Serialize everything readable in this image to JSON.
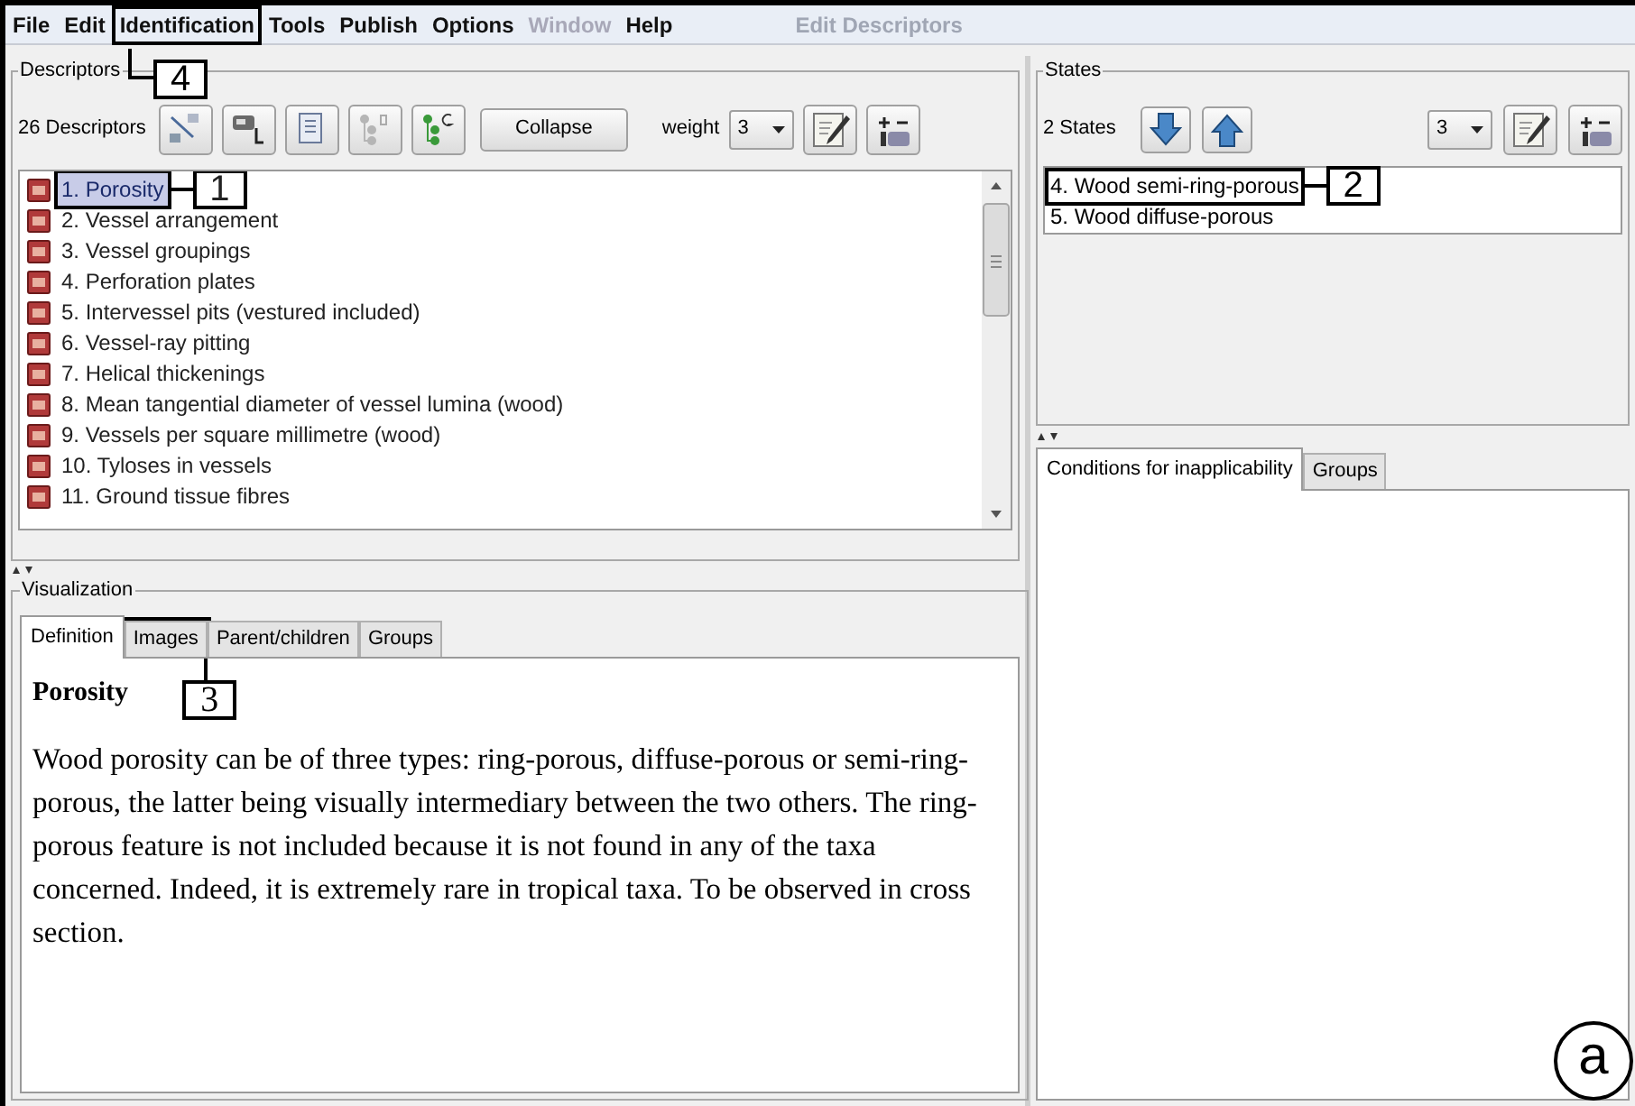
{
  "menu_bar": {
    "items": [
      {
        "label": "File",
        "disabled": false
      },
      {
        "label": "Edit",
        "disabled": false
      },
      {
        "label": "Identification",
        "disabled": false
      },
      {
        "label": "Tools",
        "disabled": false
      },
      {
        "label": "Publish",
        "disabled": false
      },
      {
        "label": "Options",
        "disabled": false
      },
      {
        "label": "Window",
        "disabled": true
      },
      {
        "label": "Help",
        "disabled": false
      }
    ],
    "window_title": "Edit Descriptors"
  },
  "descriptors": {
    "title": "Descriptors",
    "count": "26 Descriptors",
    "collapse_button": "Collapse",
    "weight_label": "weight",
    "weight_value": "3",
    "items": [
      {
        "label": "1. Porosity",
        "selected": true
      },
      {
        "label": "2. Vessel arrangement",
        "selected": false
      },
      {
        "label": "3. Vessel groupings",
        "selected": false
      },
      {
        "label": "4. Perforation plates",
        "selected": false
      },
      {
        "label": "5. Intervessel pits (vestured included)",
        "selected": false
      },
      {
        "label": "6. Vessel-ray pitting",
        "selected": false
      },
      {
        "label": "7. Helical thickenings",
        "selected": false
      },
      {
        "label": "8. Mean tangential diameter of vessel lumina (wood)",
        "selected": false
      },
      {
        "label": "9. Vessels per square millimetre (wood)",
        "selected": false
      },
      {
        "label": "10. Tyloses in vessels",
        "selected": false
      },
      {
        "label": "11. Ground tissue fibres",
        "selected": false
      }
    ]
  },
  "visualization": {
    "title": "Visualization",
    "tabs": [
      {
        "label": "Definition",
        "selected": true
      },
      {
        "label": "Images",
        "selected": false
      },
      {
        "label": "Parent/children",
        "selected": false
      },
      {
        "label": "Groups",
        "selected": false
      }
    ],
    "definition_title": "Porosity",
    "definition_text": "Wood porosity can be of three types: ring-porous, diffuse-porous or semi-ring-porous, the latter being visually intermediary between the two others. The ring-porous feature is not included because it is not found in any of the taxa concerned. Indeed, it is extremely rare in tropical taxa. To be observed in cross section."
  },
  "states": {
    "title": "States",
    "count": "2 States",
    "value": "3",
    "items": [
      {
        "label": "4. Wood semi-ring-porous",
        "selected": false
      },
      {
        "label": "5. Wood diffuse-porous",
        "selected": false
      }
    ]
  },
  "conditions": {
    "tabs": [
      {
        "label": "Conditions for inapplicability",
        "selected": true
      },
      {
        "label": "Groups",
        "selected": false
      }
    ]
  },
  "annotations": [
    {
      "label": "4"
    },
    {
      "label": "1"
    },
    {
      "label": "2"
    },
    {
      "label": "3"
    }
  ],
  "panel_label": "a"
}
